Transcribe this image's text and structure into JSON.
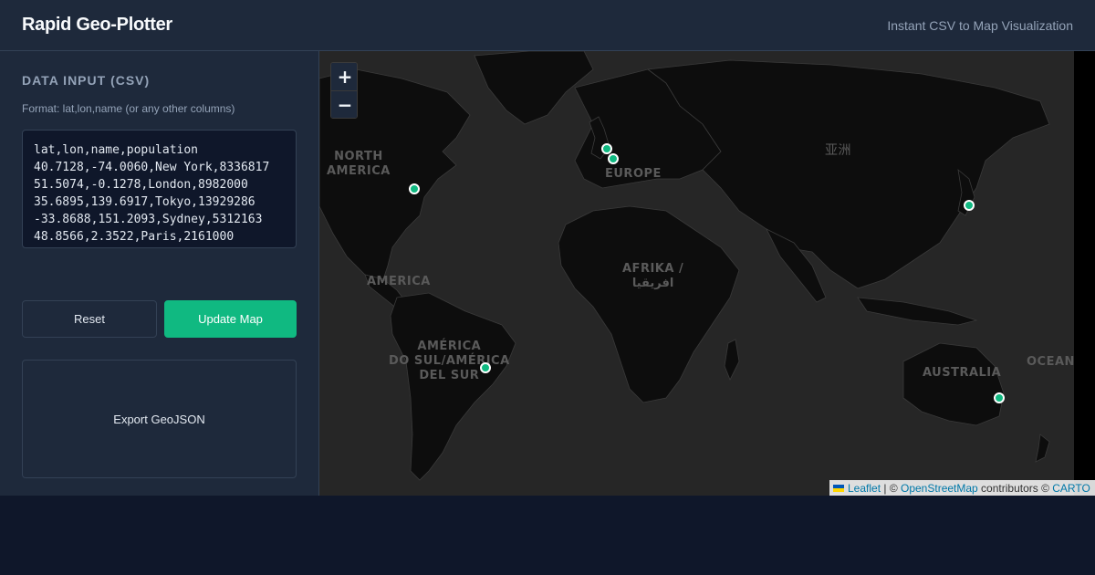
{
  "header": {
    "title": "Rapid Geo-Plotter",
    "subtitle": "Instant CSV to Map Visualization"
  },
  "sidebar": {
    "section_title": "DATA INPUT (CSV)",
    "format_hint": "Format: lat,lon,name (or any other columns)",
    "csv_value": "lat,lon,name,population\n40.7128,-74.0060,New York,8336817\n51.5074,-0.1278,London,8982000\n35.6895,139.6917,Tokyo,13929286\n-33.8688,151.2093,Sydney,5312163\n48.8566,2.3522,Paris,2161000",
    "reset_label": "Reset",
    "update_label": "Update Map",
    "export_label": "Export GeoJSON"
  },
  "map": {
    "zoom_in": "+",
    "zoom_out": "−",
    "labels": {
      "north_america": "NORTH\nAMERICA",
      "europe": "EUROPE",
      "asia": "亚洲",
      "america": "AMERICA",
      "africa": "AFRIKA /\nافريقيا",
      "south_america": "AMÉRICA\nDO SUL/AMÉRICA\nDEL SUR",
      "australia": "AUSTRALIA",
      "ocean": "OCEAN"
    },
    "attribution": {
      "leaflet": "Leaflet",
      "sep": " | © ",
      "osm": "OpenStreetMap",
      "mid": " contributors © ",
      "carto": "CARTO"
    },
    "marker_color": "#10b981",
    "background": "#262626",
    "land_color": "#0d0d0d"
  },
  "colors": {
    "accent": "#10b981",
    "panel": "#1e293b",
    "page": "#0f172a",
    "border": "#334155"
  }
}
